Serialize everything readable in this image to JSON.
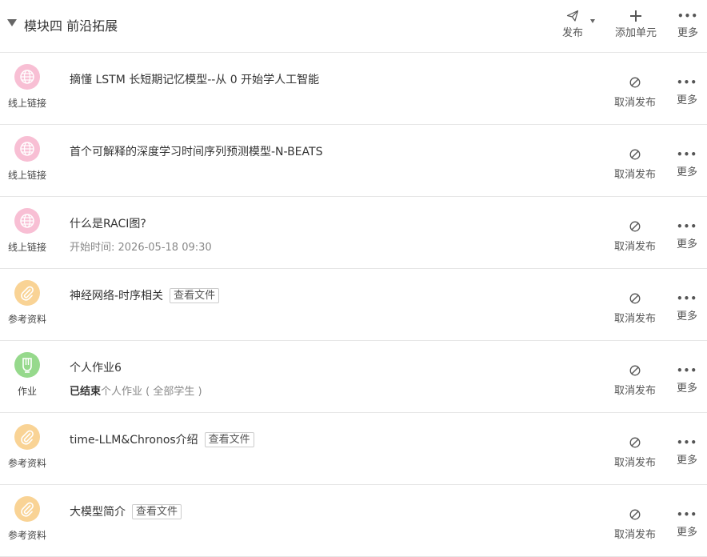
{
  "header": {
    "title": "模块四 前沿拓展",
    "publish_label": "发布",
    "add_unit_label": "添加单元",
    "more_label": "更多"
  },
  "items": [
    {
      "type": "线上链接",
      "icon": "globe-icon",
      "color": "#f8bfd4",
      "title": "摘懂 LSTM 长短期记忆模型--从 0 开始学人工智能"
    },
    {
      "type": "线上链接",
      "icon": "globe-icon",
      "color": "#f8bfd4",
      "title": "首个可解释的深度学习时间序列预测模型-N-BEATS"
    },
    {
      "type": "线上链接",
      "icon": "globe-icon",
      "color": "#f8bfd4",
      "title": "什么是RACI图?",
      "subtitle": "开始时间: 2026-05-18 09:30"
    },
    {
      "type": "参考资料",
      "icon": "paperclip-icon",
      "color": "#f9d395",
      "title": "神经网络-时序相关",
      "view_file": "查看文件"
    },
    {
      "type": "作业",
      "icon": "homework-icon",
      "color": "#96d98c",
      "title": "个人作业6",
      "status_bold": "已结束",
      "status_text": "个人作业 ( 全部学生 )"
    },
    {
      "type": "参考资料",
      "icon": "paperclip-icon",
      "color": "#f9d395",
      "title": "time-LLM&Chronos介绍",
      "view_file": "查看文件"
    },
    {
      "type": "参考资料",
      "icon": "paperclip-icon",
      "color": "#f9d395",
      "title": "大模型简介",
      "view_file": "查看文件"
    }
  ],
  "row_actions": {
    "unpublish_label": "取消发布",
    "more_label": "更多"
  }
}
